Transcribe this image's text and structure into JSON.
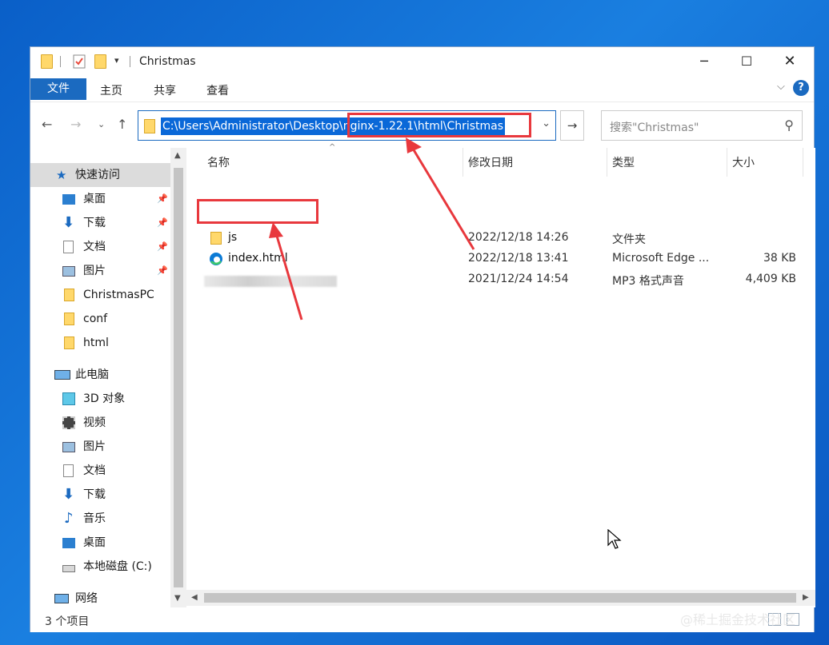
{
  "window": {
    "title": "Christmas"
  },
  "ribbon": {
    "tabs": [
      {
        "label": "文件"
      },
      {
        "label": "主页"
      },
      {
        "label": "共享"
      },
      {
        "label": "查看"
      }
    ]
  },
  "address": {
    "path": "C:\\Users\\Administrator\\Desktop\\nginx-1.22.1\\html\\Christmas"
  },
  "search": {
    "placeholder": "搜索\"Christmas\""
  },
  "sidebar": {
    "items": [
      {
        "label": "快速访问",
        "icon": "star-icon"
      },
      {
        "label": "桌面",
        "icon": "desktop-icon",
        "pinned": true
      },
      {
        "label": "下载",
        "icon": "download-icon",
        "pinned": true
      },
      {
        "label": "文档",
        "icon": "document-icon",
        "pinned": true
      },
      {
        "label": "图片",
        "icon": "picture-icon",
        "pinned": true
      },
      {
        "label": "ChristmasPC",
        "icon": "folder-icon"
      },
      {
        "label": "conf",
        "icon": "folder-icon"
      },
      {
        "label": "html",
        "icon": "folder-icon"
      },
      {
        "label": "此电脑",
        "icon": "computer-icon"
      },
      {
        "label": "3D 对象",
        "icon": "cube-icon"
      },
      {
        "label": "视频",
        "icon": "video-icon"
      },
      {
        "label": "图片",
        "icon": "picture-icon"
      },
      {
        "label": "文档",
        "icon": "document-icon"
      },
      {
        "label": "下载",
        "icon": "download-icon"
      },
      {
        "label": "音乐",
        "icon": "music-icon"
      },
      {
        "label": "桌面",
        "icon": "desktop-icon"
      },
      {
        "label": "本地磁盘 (C:)",
        "icon": "drive-icon"
      },
      {
        "label": "网络",
        "icon": "network-icon"
      }
    ]
  },
  "columns": [
    {
      "label": "名称"
    },
    {
      "label": "修改日期"
    },
    {
      "label": "类型"
    },
    {
      "label": "大小"
    }
  ],
  "files": [
    {
      "name": "js",
      "date": "2022/12/18 14:26",
      "type": "文件夹",
      "size": ""
    },
    {
      "name": "index.html",
      "date": "2022/12/18 13:41",
      "type": "Microsoft Edge ...",
      "size": "38 KB"
    },
    {
      "name": "",
      "date": "2021/12/24 14:54",
      "type": "MP3 格式声音",
      "size": "4,409 KB"
    }
  ],
  "status": {
    "count": "3 个项目"
  },
  "watermark": "@稀土掘金技术社区",
  "colors": {
    "accent": "#1b6ac0",
    "highlight": "#e8383d",
    "folder": "#ffd86b"
  }
}
